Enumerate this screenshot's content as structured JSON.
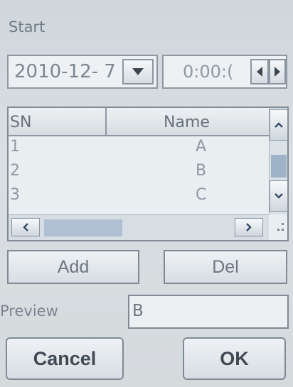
{
  "start_label": "Start",
  "date": {
    "value": "2010-12- 7"
  },
  "time": {
    "value": "0:00:("
  },
  "table": {
    "headers": [
      "SN",
      "Name"
    ],
    "rows": [
      {
        "sn": "1",
        "name": "A"
      },
      {
        "sn": "2",
        "name": "B"
      },
      {
        "sn": "3",
        "name": "C"
      }
    ]
  },
  "buttons": {
    "add": "Add",
    "del": "Del",
    "cancel": "Cancel",
    "ok": "OK"
  },
  "preview": {
    "label": "Preview",
    "value": "B"
  },
  "colors": {
    "accent_thumb": "#9eb3c8",
    "arrow": "#3a4d6a"
  }
}
